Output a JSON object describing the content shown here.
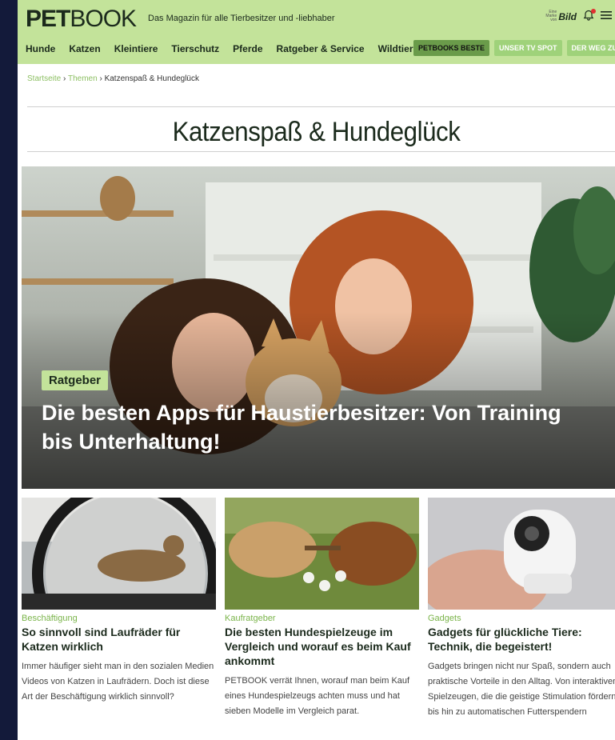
{
  "header": {
    "logo_bold": "PET",
    "logo_rest": "BOOK",
    "tagline": "Das Magazin für alle Tierbesitzer und -liebhaber",
    "bild_small": "Eine Marke von",
    "bild_word": "Bild",
    "icons": [
      "bell-icon",
      "menu-icon"
    ]
  },
  "nav": {
    "items": [
      "Hunde",
      "Katzen",
      "Kleintiere",
      "Tierschutz",
      "Pferde",
      "Ratgeber & Service",
      "Wildtiere"
    ],
    "pills": [
      "PETBOOKS BESTE",
      "UNSER TV SPOT",
      "DER WEG ZUM HUND"
    ]
  },
  "breadcrumb": {
    "home": "Startseite",
    "section": "Themen",
    "current": "Katzenspaß & Hundeglück",
    "separator": "›"
  },
  "page": {
    "title": "Katzenspaß & Hundeglück"
  },
  "hero": {
    "badge": "Ratgeber",
    "title": "Die besten Apps für Haustierbesitzer: Von Training bis Unterhaltung!"
  },
  "cards": [
    {
      "category": "Beschäftigung",
      "title": "So sinnvoll sind Laufräder für Katzen wirklich",
      "text": "Immer häufiger sieht man in den sozialen Medien Videos von Katzen in Laufrädern. Doch ist diese Art der Beschäftigung wirklich sinnvoll?"
    },
    {
      "category": "Kaufratgeber",
      "title": "Die besten Hundespielzeuge im Vergleich und worauf es beim Kauf ankommt",
      "text": "PETBOOK verrät Ihnen, worauf man beim Kauf eines Hundespielzeugs achten muss und hat sieben Modelle im Vergleich parat."
    },
    {
      "category": "Gadgets",
      "title": "Gadgets für glückliche Tiere: Technik, die begeistert!",
      "text": "Gadgets bringen nicht nur Spaß, sondern auch praktische Vorteile in den Alltag. Von interaktiven Spielzeugen, die die geistige Stimulation fördern, bis hin zu automatischen Futterspendern"
    }
  ],
  "colors": {
    "accent_green": "#c3e39a",
    "category_green": "#7ab44a",
    "dark_text": "#1b2a1c",
    "background": "#131a3a"
  }
}
